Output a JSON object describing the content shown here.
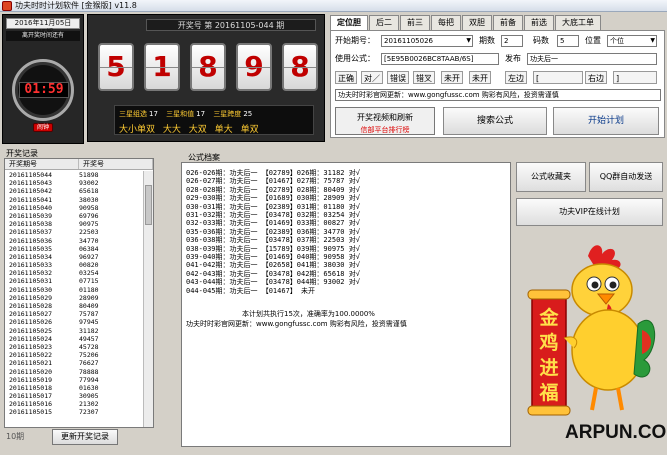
{
  "window": {
    "title": "功夫时时计划软件 [金猴版] v11.8"
  },
  "clock": {
    "date": "2016年11月05日 045期",
    "subtitle": "离开奖时间还有",
    "time": "01:59",
    "alarm_label": "闹钟"
  },
  "draw": {
    "issue_text": "开奖号  第 20161105-044 期",
    "digits": [
      "5",
      "1",
      "8",
      "9",
      "8"
    ],
    "stats_row1": [
      {
        "label": "三星组选",
        "value": "17"
      },
      {
        "label": "三星和值",
        "value": "17"
      },
      {
        "label": "三星跨度",
        "value": "25"
      }
    ],
    "stats_row2": [
      "大小单双",
      "大大",
      "大双",
      "单大",
      "单双"
    ]
  },
  "tabs": [
    "定位胆",
    "后二",
    "前三",
    "每把",
    "双胆",
    "前备",
    "前选",
    "大底工单"
  ],
  "settings": {
    "start_label": "开始期号：",
    "start_value": "20161105026",
    "period_label": "期数",
    "period_value": "2",
    "digits_label": "码数",
    "digits_value": "5",
    "position_label": "位置",
    "position_value": "个位",
    "formula_label": "使用公式：",
    "formula_value": "[5E95B0026BC8TAAB/6S]",
    "send_label": "发布",
    "send_value": "功夫后一",
    "options": [
      "正确",
      "对／",
      "错误",
      "错叉",
      "未开",
      "未开",
      "左边",
      "[",
      "右边",
      "]"
    ],
    "website": "功夫时时彩官网更新：www.gongfussc.com 购彩有风险，投资需谨慎",
    "open_video_label": "开奖视频和刷新",
    "open_video_sub": "信部平台排行榜",
    "search_formula": "搜索公式",
    "start_calc": "开始计划"
  },
  "history": {
    "label": "开奖记录",
    "headers": [
      "开奖期号",
      "开奖号"
    ],
    "rows": [
      [
        "20161105044",
        "51898"
      ],
      [
        "20161105043",
        "93002"
      ],
      [
        "20161105042",
        "65618"
      ],
      [
        "20161105041",
        "38030"
      ],
      [
        "20161105040",
        "90958"
      ],
      [
        "20161105039",
        "69796"
      ],
      [
        "20161105038",
        "90975"
      ],
      [
        "20161105037",
        "22503"
      ],
      [
        "20161105036",
        "34770"
      ],
      [
        "20161105035",
        "06384"
      ],
      [
        "20161105034",
        "96927"
      ],
      [
        "20161105033",
        "00820"
      ],
      [
        "20161105032",
        "03254"
      ],
      [
        "20161105031",
        "07715"
      ],
      [
        "20161105030",
        "01180"
      ],
      [
        "20161105029",
        "28909"
      ],
      [
        "20161105028",
        "80409"
      ],
      [
        "20161105027",
        "75787"
      ],
      [
        "20161105026",
        "97945"
      ],
      [
        "20161105025",
        "31182"
      ],
      [
        "20161105024",
        "49457"
      ],
      [
        "20161105023",
        "45728"
      ],
      [
        "20161105022",
        "75206"
      ],
      [
        "20161105021",
        "76627"
      ],
      [
        "20161105020",
        "78888"
      ],
      [
        "20161105019",
        "77994"
      ],
      [
        "20161105018",
        "01630"
      ],
      [
        "20161105017",
        "30905"
      ],
      [
        "20161105016",
        "21302"
      ],
      [
        "20161105015",
        "72307"
      ]
    ],
    "footer": "10期",
    "update_button": "更新开奖记录"
  },
  "formula": {
    "label": "公式档案",
    "lines": [
      "026-026期：功夫后一 【02789】026期：31182 对√",
      "026-027期：功夫后一 【01467】027期：75787 对√",
      "028-028期：功夫后一 【02789】028期：80409 对√",
      "029-030期：功夫后一 【01689】030期：28909 对√",
      "030-031期：功夫后一 【02389】031期：01180 对√",
      "031-032期：功夫后一 【03478】032期：03254 对√",
      "032-033期：功夫后一 【01469】033期：00827 对√",
      "035-036期：功夫后一 【02389】036期：34770 对√",
      "036-038期：功夫后一 【03478】037期：22503 对√",
      "038-039期：功夫后一 【15789】039期：90975 对√",
      "039-040期：功夫后一 【01469】040期：90958 对√",
      "041-042期：功夫后一 【02658】041期：38030 对√",
      "042-043期：功夫后一 【03478】042期：65618 对√",
      "043-044期：功夫后一 【03478】044期：93002 对√",
      "044-045期：功夫后一 【01467】 未开"
    ],
    "summary": "本计划共执行15次，准确率为100.0000%",
    "website": "功夫时时彩官网更新：www.gongfussc.com 购彩有风险，投资需谨慎"
  },
  "right_buttons": {
    "collect": "公式收藏夹",
    "auto_send": "QQ群自动发送",
    "vip": "功夫VIP在线计划"
  },
  "mascot": {
    "banner_text": [
      "金",
      "鸡",
      "进",
      "福"
    ]
  },
  "watermark": "ARPUN.COM"
}
